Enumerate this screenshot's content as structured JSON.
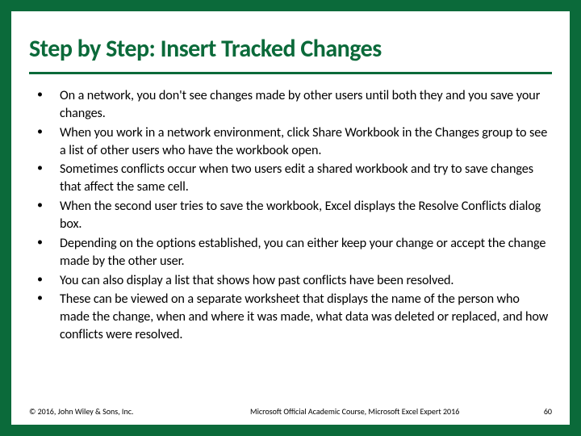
{
  "title": "Step by Step: Insert Tracked Changes",
  "bullets": [
    "On a network, you don't see changes made by other users until both they and you save your changes.",
    "When you work in a network environment, click Share Workbook in the Changes group to see a list of other users who have the workbook open.",
    "Sometimes conflicts occur when two users edit a shared workbook and try to save changes that affect the same cell.",
    "When the second user tries to save the workbook, Excel displays the Resolve Conflicts dialog box.",
    "Depending on the options established, you can either keep your change or accept the change made by the other user.",
    "You can also display a list that shows how past conflicts have been resolved.",
    "These can be viewed on a separate worksheet that displays the name of the person who made the change, when and where it was made, what data was deleted or replaced, and how conflicts were resolved."
  ],
  "footer": {
    "left": "© 2016, John Wiley & Sons, Inc.",
    "center": "Microsoft Official Academic Course, Microsoft Excel Expert 2016",
    "right": "60"
  }
}
